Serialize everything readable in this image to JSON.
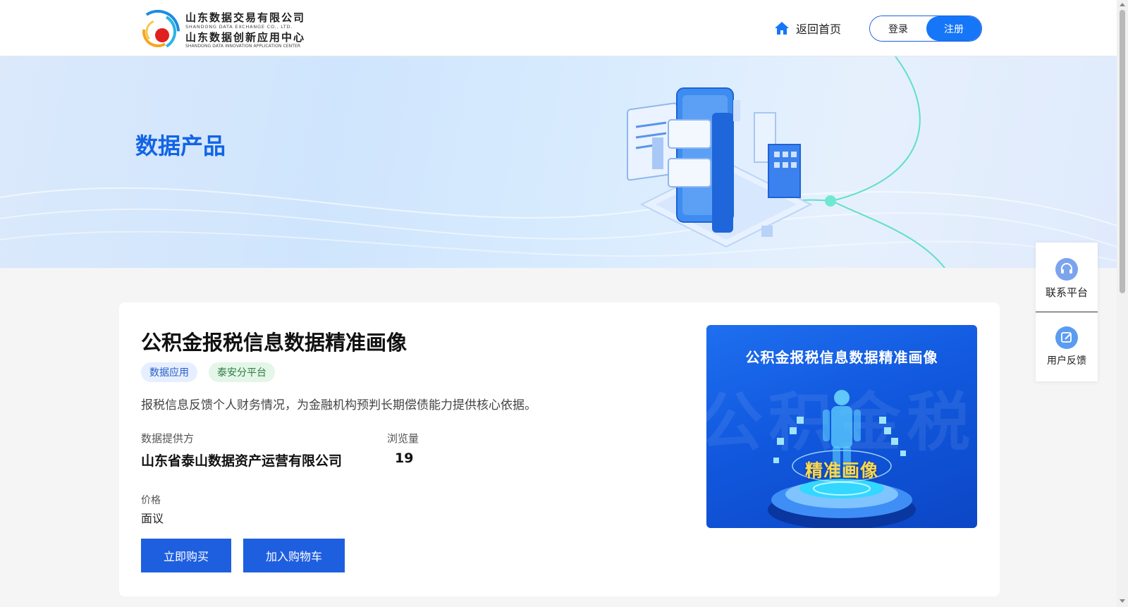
{
  "header": {
    "logo": {
      "cn_line1": "山东数据交易有限公司",
      "en_line1": "SHANDONG DATA EXCHANGE CO., LTD.",
      "cn_line2": "山东数据创新应用中心",
      "en_line2": "SHANDONG DATA INNOVATION APPLICATION CENTER"
    },
    "home_label": "返回首页",
    "login_label": "登录",
    "register_label": "注册"
  },
  "banner": {
    "title": "数据产品"
  },
  "product": {
    "title": "公积金报税信息数据精准画像",
    "tags": [
      "数据应用",
      "泰安分平台"
    ],
    "description": "报税信息反馈个人财务情况，为金融机构预判长期偿债能力提供核心依据。",
    "provider_label": "数据提供方",
    "provider_value": "山东省泰山数据资产运营有限公司",
    "views_label": "浏览量",
    "views_value": "19",
    "price_label": "价格",
    "price_value": "面议",
    "buy_label": "立即购买",
    "cart_label": "加入购物车",
    "image": {
      "title": "公积金报税信息数据精准画像",
      "badge": "精准画像",
      "watermark": "公积金税"
    }
  },
  "side_panel": {
    "contact_label": "联系平台",
    "feedback_label": "用户反馈"
  },
  "colors": {
    "primary": "#1e5fe0",
    "accent": "#1676f8",
    "banner_title": "#1264e6"
  },
  "icons": [
    "home-icon",
    "headset-icon",
    "edit-icon"
  ]
}
